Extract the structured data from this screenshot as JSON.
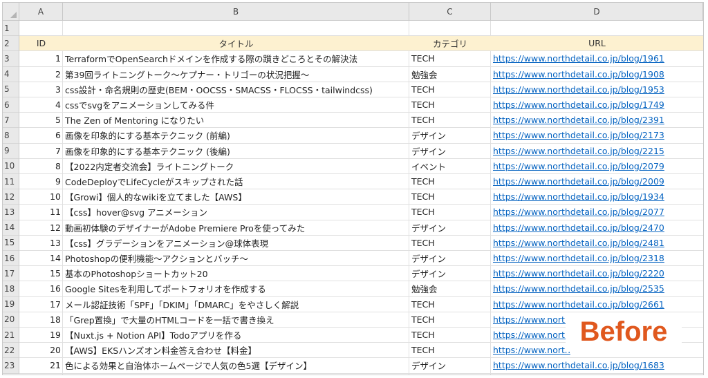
{
  "columns": [
    "A",
    "B",
    "C",
    "D"
  ],
  "headers": {
    "id": "ID",
    "title": "タイトル",
    "category": "カテゴリ",
    "url": "URL"
  },
  "rows": [
    {
      "id": "1",
      "title": "TerraformでOpenSearchドメインを作成する際の躓きどころとその解決法",
      "category": "TECH",
      "url": "https://www.northdetail.co.jp/blog/1961"
    },
    {
      "id": "2",
      "title": "第39回ライトニングトーク～ケプナー・トリゴーの状況把握～",
      "category": "勉強会",
      "url": "https://www.northdetail.co.jp/blog/1908"
    },
    {
      "id": "3",
      "title": "css設計・命名規則の歴史(BEM・OOCSS・SMACSS・FLOCSS・tailwindcss)",
      "category": "TECH",
      "url": "https://www.northdetail.co.jp/blog/1953"
    },
    {
      "id": "4",
      "title": "cssでsvgをアニメーションしてみる件",
      "category": "TECH",
      "url": "https://www.northdetail.co.jp/blog/1749"
    },
    {
      "id": "5",
      "title": "The Zen of Mentoring になりたい",
      "category": "TECH",
      "url": "https://www.northdetail.co.jp/blog/2391"
    },
    {
      "id": "6",
      "title": "画像を印象的にする基本テクニック (前編)",
      "category": "デザイン",
      "url": "https://www.northdetail.co.jp/blog/2173"
    },
    {
      "id": "7",
      "title": "画像を印象的にする基本テクニック (後編)",
      "category": "デザイン",
      "url": "https://www.northdetail.co.jp/blog/2215"
    },
    {
      "id": "8",
      "title": "【2022内定者交流会】ライトニングトーク",
      "category": "イベント",
      "url": "https://www.northdetail.co.jp/blog/2079"
    },
    {
      "id": "9",
      "title": "CodeDeployでLifeCycleがスキップされた話",
      "category": "TECH",
      "url": "https://www.northdetail.co.jp/blog/2009"
    },
    {
      "id": "10",
      "title": "【Growi】個人的なwikiを立てました【AWS】",
      "category": "TECH",
      "url": "https://www.northdetail.co.jp/blog/1934"
    },
    {
      "id": "11",
      "title": "【css】hover@svg アニメーション",
      "category": "TECH",
      "url": "https://www.northdetail.co.jp/blog/2077"
    },
    {
      "id": "12",
      "title": "動画初体験のデザイナーがAdobe Premiere Proを使ってみた",
      "category": "デザイン",
      "url": "https://www.northdetail.co.jp/blog/2470"
    },
    {
      "id": "13",
      "title": "【css】グラデーションをアニメーション@球体表現",
      "category": "TECH",
      "url": "https://www.northdetail.co.jp/blog/2481"
    },
    {
      "id": "14",
      "title": "Photoshopの便利機能～アクションとバッチ～",
      "category": "デザイン",
      "url": "https://www.northdetail.co.jp/blog/2318"
    },
    {
      "id": "15",
      "title": "基本のPhotoshopショートカット20",
      "category": "デザイン",
      "url": "https://www.northdetail.co.jp/blog/2220"
    },
    {
      "id": "16",
      "title": "Google Sitesを利用してポートフォリオを作成する",
      "category": "勉強会",
      "url": "https://www.northdetail.co.jp/blog/2535"
    },
    {
      "id": "17",
      "title": "メール認証技術「SPF」「DKIM」「DMARC」をやさしく解説",
      "category": "TECH",
      "url": "https://www.northdetail.co.jp/blog/2661"
    },
    {
      "id": "18",
      "title": "「Grep置換」で大量のHTMLコードを一括で書き換え",
      "category": "TECH",
      "url": "https://www.north"
    },
    {
      "id": "19",
      "title": "【Nuxt.js + Notion API】Todoアプリを作る",
      "category": "TECH",
      "url": "https://www.north"
    },
    {
      "id": "20",
      "title": "【AWS】EKSハンズオン料金答え合わせ【料金】",
      "category": "TECH",
      "url": "https://www.north"
    },
    {
      "id": "21",
      "title": "色による効果と自治体ホームページで人気の色5選【デザイン】",
      "category": "デザイン",
      "url": "https://www.northdetail.co.jp/blog/1683"
    }
  ],
  "overlay": {
    "label": "Before",
    "color": "#e0581e"
  },
  "colors": {
    "header_fill": "#fdf1d0",
    "link": "#0563c1"
  }
}
